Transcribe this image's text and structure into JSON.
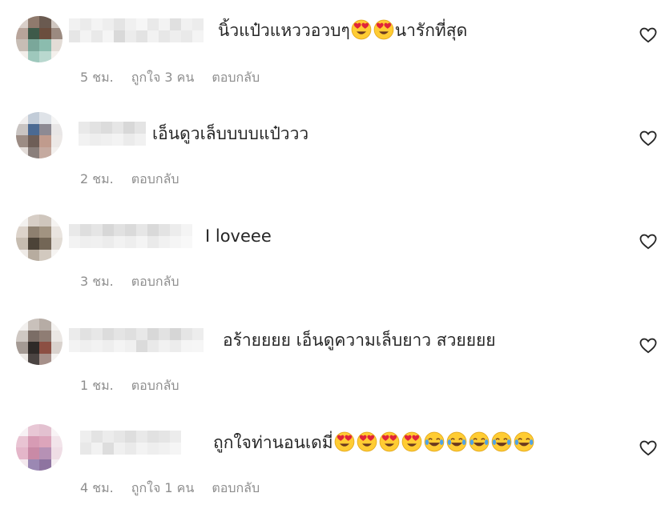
{
  "comments": [
    {
      "text_before": "นิ้วแป๋วแหววอวบๆ",
      "emojis_mid": [
        "heart-eyes",
        "heart-eyes"
      ],
      "text_after": "นารักที่สุด",
      "emojis_end": [],
      "time": "5 ชม.",
      "likes": "ถูกใจ 3 คน",
      "reply": "ตอบกลับ"
    },
    {
      "text_before": "เอ็นดูวเล็บบบบแป๋ววว",
      "emojis_mid": [],
      "text_after": "",
      "emojis_end": [],
      "time": "2 ชม.",
      "likes": "",
      "reply": "ตอบกลับ"
    },
    {
      "text_before": "I loveee",
      "emojis_mid": [],
      "text_after": "",
      "emojis_end": [],
      "time": "3 ชม.",
      "likes": "",
      "reply": "ตอบกลับ"
    },
    {
      "text_before": "อร้ายยยย เอ็นดูความเล็บยาว สวยยยย",
      "emojis_mid": [],
      "text_after": "",
      "emojis_end": [],
      "time": "1 ชม.",
      "likes": "",
      "reply": "ตอบกลับ"
    },
    {
      "text_before": "ถูกใจท่านอนเดมี่",
      "emojis_mid": [],
      "text_after": "",
      "emojis_end": [
        "heart-eyes",
        "heart-eyes",
        "heart-eyes",
        "heart-eyes",
        "joy",
        "joy",
        "joy",
        "joy",
        "joy"
      ],
      "time": "4 ชม.",
      "likes": "ถูกใจ 1 คน",
      "reply": "ตอบกลับ"
    }
  ],
  "icons": {
    "like": "heart-outline-icon"
  },
  "colors": {
    "text": "#262626",
    "meta": "#8e8e8e",
    "emoji_face": "#FFCC33",
    "emoji_heart": "#E0243A",
    "tear": "#4FA3E6"
  }
}
